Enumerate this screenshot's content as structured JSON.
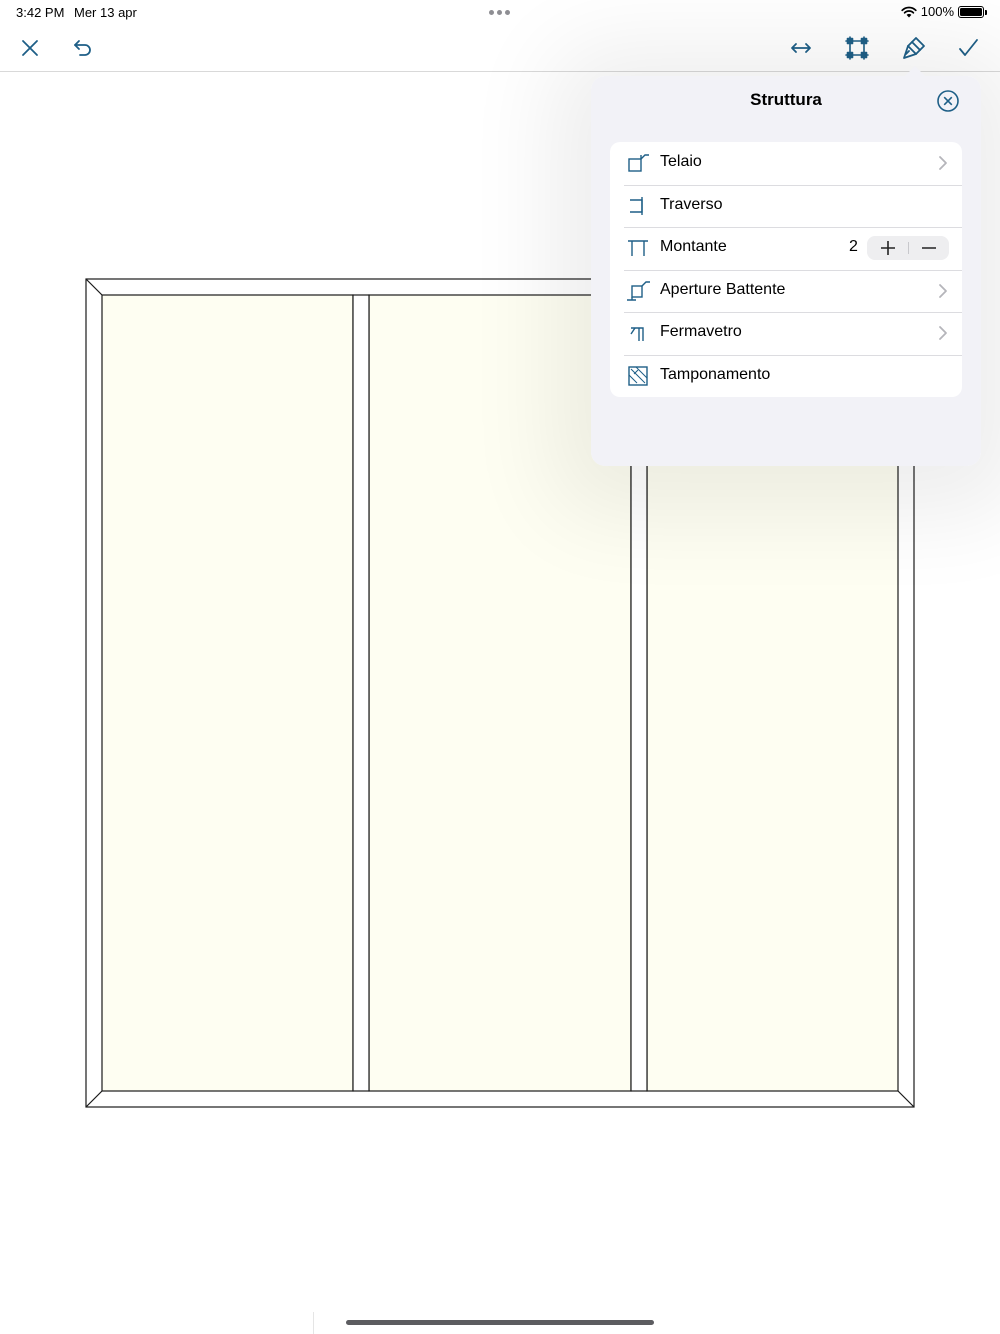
{
  "status_bar": {
    "time": "3:42 PM",
    "date": "Mer 13 apr",
    "battery": "100%"
  },
  "toolbar": {
    "left_icons": [
      "close-icon",
      "undo-icon"
    ],
    "right_icons": [
      "resize-horizontal-icon",
      "transform-icon",
      "paint-brush-icon",
      "checkmark-icon"
    ]
  },
  "popover": {
    "title": "Struttura",
    "items": [
      {
        "label": "Telaio",
        "icon": "telaio-icon",
        "has_chevron": true
      },
      {
        "label": "Traverso",
        "icon": "traverso-icon",
        "has_chevron": false
      },
      {
        "label": "Montante",
        "icon": "montante-icon",
        "has_chevron": false,
        "count": "2"
      },
      {
        "label": "Aperture Battente",
        "icon": "aperture-battente-icon",
        "has_chevron": true
      },
      {
        "label": "Fermavetro",
        "icon": "fermavetro-icon",
        "has_chevron": true
      },
      {
        "label": "Tamponamento",
        "icon": "tamponamento-icon",
        "has_chevron": false
      }
    ]
  },
  "colors": {
    "accent": "#1e5f87",
    "glass_fill": "#fefef2",
    "frame_stroke": "#1a1a1a",
    "popover_bg": "#f2f2f7"
  },
  "drawing": {
    "mullion_count": 2
  }
}
